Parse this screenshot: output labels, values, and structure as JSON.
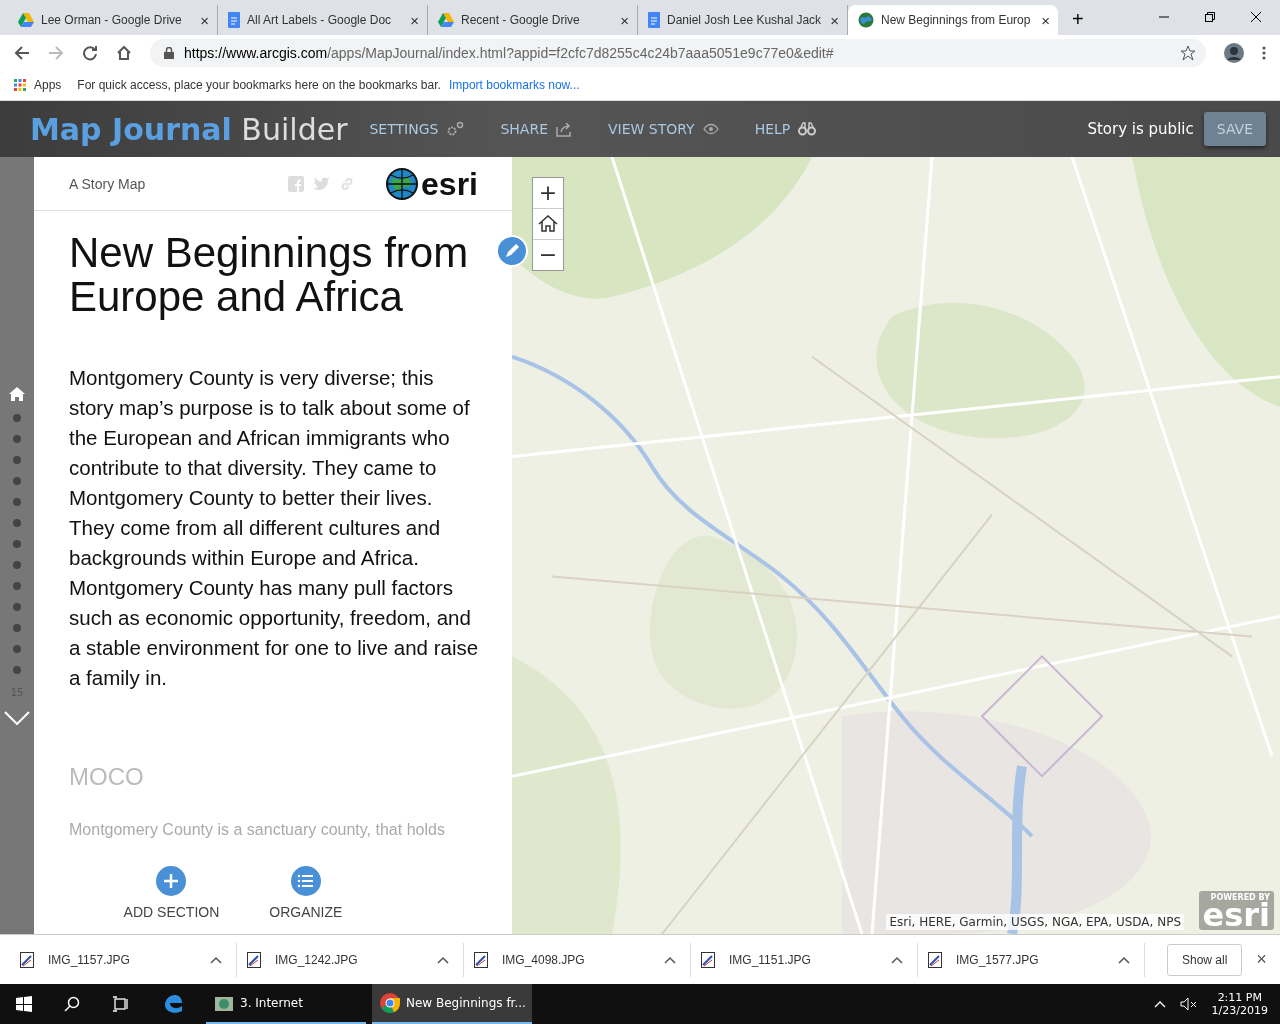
{
  "browser": {
    "tabs": [
      {
        "title": "Lee Orman - Google Drive",
        "kind": "drive",
        "selected": false,
        "close": "×"
      },
      {
        "title": "All Art Labels - Google Doc",
        "kind": "doc",
        "selected": false,
        "close": "×"
      },
      {
        "title": "Recent - Google Drive",
        "kind": "drive",
        "selected": false,
        "close": "×"
      },
      {
        "title": "Daniel Josh Lee Kushal Jack",
        "kind": "doc",
        "selected": false,
        "close": "×"
      },
      {
        "title": "New Beginnings from Europ",
        "kind": "site",
        "selected": true,
        "close": "×"
      }
    ],
    "new_tab": "+",
    "url_host": "https://www.arcgis.com",
    "url_path": "/apps/MapJournal/index.html?appid=f2cfc7d8255c4c24b7aaa5051e9c77e0&edit#",
    "bookmarks": {
      "apps": "Apps",
      "hint": "For quick access, place your bookmarks here on the bookmarks bar.",
      "link": "Import bookmarks now..."
    }
  },
  "builder": {
    "title_accent": "Map Journal",
    "title_rest": "Builder",
    "nav": [
      "SETTINGS",
      "SHARE",
      "VIEW STORY",
      "HELP"
    ],
    "status": "Story is public",
    "save": "SAVE"
  },
  "sidebar": {
    "sections": [
      {
        "kind": "home",
        "selected": true
      },
      {
        "kind": "dot",
        "selected": false
      },
      {
        "kind": "dot",
        "selected": false
      },
      {
        "kind": "dot",
        "selected": false
      },
      {
        "kind": "dot",
        "selected": false
      },
      {
        "kind": "dot",
        "selected": false
      },
      {
        "kind": "dot",
        "selected": false
      },
      {
        "kind": "dot",
        "selected": false
      },
      {
        "kind": "dot",
        "selected": false
      },
      {
        "kind": "dot",
        "selected": false
      },
      {
        "kind": "dot",
        "selected": false
      },
      {
        "kind": "dot",
        "selected": false
      },
      {
        "kind": "dot",
        "selected": false
      },
      {
        "kind": "dot",
        "selected": false
      }
    ],
    "count": "15"
  },
  "panel": {
    "kicker": "A Story Map",
    "logo": "esri",
    "title": "New Beginnings from Europe and Africa",
    "body": "Montgomery County is very diverse; this story map’s purpose is to talk about some of the European and African immigrants who contribute to that diversity. They came to Montgomery County to better their lives. They come from all different cultures and backgrounds within Europe and Africa. Montgomery County has many pull factors such as economic opportunity, freedom, and a stable environment for one to live and raise a family in.",
    "next_title": "MOCO",
    "next_text": "Montgomery County is a sanctuary county, that holds",
    "actions": [
      "ADD SECTION",
      "ORGANIZE"
    ]
  },
  "map": {
    "kind": "picture",
    "zoom_in": "+",
    "zoom_out": "−",
    "attribution": "Esri, HERE, Garmin, USGS, NGA, EPA, USDA, NPS",
    "powered_by": "POWERED BY",
    "powered_logo": "esri"
  },
  "downloads": {
    "files": [
      "IMG_1157.JPG",
      "IMG_1242.JPG",
      "IMG_4098.JPG",
      "IMG_1151.JPG",
      "IMG_1577.JPG"
    ],
    "show_all": "Show all",
    "close": "×"
  },
  "taskbar": {
    "apps": [
      {
        "label": "3. Internet",
        "selected": false
      },
      {
        "label": "New Beginnings fr...",
        "selected": true
      }
    ],
    "time": "2:11 PM",
    "date": "1/23/2019"
  }
}
